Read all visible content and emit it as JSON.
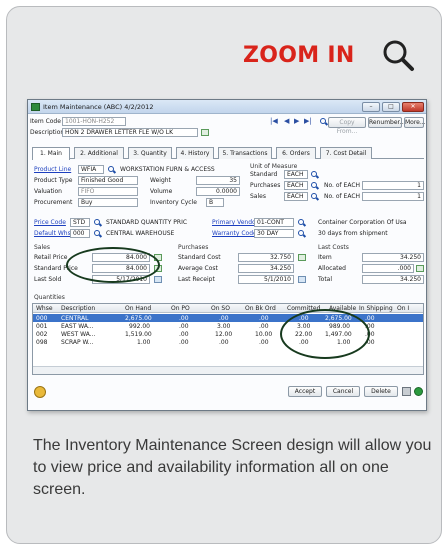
{
  "zoom": {
    "label": "ZOOM IN",
    "icon": "magnifier-icon"
  },
  "window": {
    "title": "Item Maintenance (ABC) 4/2/2012",
    "buttons": {
      "minimize": "–",
      "maximize": "□",
      "close": "✕"
    }
  },
  "header": {
    "item_code_label": "Item Code",
    "item_code": "1001-HON-H252",
    "description_label": "Description",
    "description": "HON 2 DRAWER LETTER FLE W/O LK",
    "copy_from": "Copy From...",
    "renumber": "Renumber...",
    "more": "More..."
  },
  "tabs": [
    "1. Main",
    "2. Additional",
    "3. Quantity",
    "4. History",
    "5. Transactions",
    "6. Orders",
    "7. Cost Detail"
  ],
  "main": {
    "product_line_label": "Product Line",
    "product_line": "WFIA",
    "product_line_desc": "WORKSTATION FURN & ACCESS",
    "product_type_label": "Product Type",
    "product_type": "Finished Good",
    "valuation_label": "Valuation",
    "valuation": "FIFO",
    "procurement_label": "Procurement",
    "procurement": "Buy",
    "weight_label": "Weight",
    "weight": "35",
    "volume_label": "Volume",
    "volume": "0.0000",
    "inventory_cycle_label": "Inventory Cycle",
    "inventory_cycle": "B",
    "uom_title": "Unit of Measure",
    "standard_label": "Standard",
    "standard_uom": "EACH",
    "purchases_label": "Purchases",
    "purchases_uom": "EACH",
    "sales_label": "Sales",
    "sales_uom": "EACH",
    "no_of_each_label": "No. of EACH",
    "no_of_each_purchases": "1",
    "no_of_each_sales": "1",
    "price_code_label": "Price Code",
    "price_code": "STD",
    "price_code_desc": "STANDARD QUANTITY PRIC",
    "default_whse_label": "Default Whse",
    "default_whse": "000",
    "default_whse_desc": "CENTRAL WAREHOUSE",
    "primary_vendor_label": "Primary Vendor",
    "primary_vendor": "01-CONT",
    "primary_vendor_desc": "Container Corporation Of Usa",
    "warranty_code_label": "Warranty Code",
    "warranty_code": "30 DAY",
    "warranty_desc": "30 days from shipment"
  },
  "sales": {
    "title": "Sales",
    "retail_price_label": "Retail Price",
    "retail_price": "84.000",
    "standard_price_label": "Standard Price",
    "standard_price": "84.000",
    "last_sold_label": "Last Sold",
    "last_sold": "5/17/2010"
  },
  "purchases": {
    "title": "Purchases",
    "standard_cost_label": "Standard Cost",
    "standard_cost": "32.750",
    "average_cost_label": "Average Cost",
    "average_cost": "34.250",
    "last_receipt_label": "Last Receipt",
    "last_receipt": "5/1/2010"
  },
  "last_costs": {
    "title": "Last Costs",
    "item_label": "Item",
    "item": "34.250",
    "allocated_label": "Allocated",
    "allocated": ".000",
    "total_label": "Total",
    "total": "34.250"
  },
  "quantities": {
    "title": "Quantities",
    "columns": [
      "Whse",
      "Description",
      "On Hand",
      "On PO",
      "On SO",
      "On Bk Ord",
      "Committed",
      "Available",
      "In Shipping",
      "On I"
    ],
    "rows": [
      [
        "000",
        "CENTRAL",
        "2,675.00",
        ".00",
        ".00",
        ".00",
        ".00",
        "2,675.00",
        ".00"
      ],
      [
        "001",
        "EAST WA...",
        "992.00",
        ".00",
        "3.00",
        ".00",
        "3.00",
        "989.00",
        ".00"
      ],
      [
        "002",
        "WEST WA...",
        "1,519.00",
        ".00",
        "12.00",
        "10.00",
        "22.00",
        "1,497.00",
        ".00"
      ],
      [
        "098",
        "SCRAP W...",
        "1.00",
        ".00",
        ".00",
        ".00",
        ".00",
        "1.00",
        ".00"
      ]
    ]
  },
  "footer": {
    "accept": "Accept",
    "cancel": "Cancel",
    "delete": "Delete"
  },
  "caption": "The Inventory Maintenance Screen design will allow you to view price and availability information all on one screen.",
  "colors": {
    "accent": "#d9241b",
    "highlight_row": "#3b73c9",
    "card_bg": "#e7e8e9",
    "ellipse": "#173a1e"
  }
}
